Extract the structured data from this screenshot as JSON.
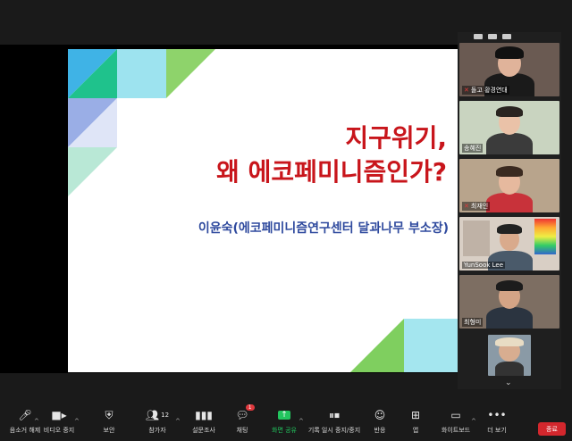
{
  "slide": {
    "title_line1": "지구위기,",
    "title_line2": "왜 에코페미니즘인가?",
    "presenter": "이윤숙(에코페미니즘연구센터 달과나무 부소장)"
  },
  "participants": [
    {
      "name": "돌고 황경연대",
      "muted": true
    },
    {
      "name": "송혜진",
      "muted": false
    },
    {
      "name": "최재인",
      "muted": true
    },
    {
      "name": "YunSook Lee",
      "muted": false
    },
    {
      "name": "최형미",
      "muted": false
    },
    {
      "name": "",
      "muted": false
    }
  ],
  "toolbar": {
    "unmute": "음소거 해제",
    "video": "비디오 중지",
    "security": "보안",
    "participants": "참가자",
    "participants_count": "12",
    "polls": "설문조사",
    "chat": "채팅",
    "chat_badge": "1",
    "share": "화면 공유",
    "record": "기록 일시 중지/중지",
    "reactions": "반응",
    "apps": "앱",
    "whiteboard": "화이트보드",
    "more": "더 보기",
    "end": "종료"
  },
  "colors": {
    "title_red": "#c8151b",
    "presenter_blue": "#2f4a9e",
    "end_red": "#d3272d",
    "share_green": "#22c55e"
  }
}
